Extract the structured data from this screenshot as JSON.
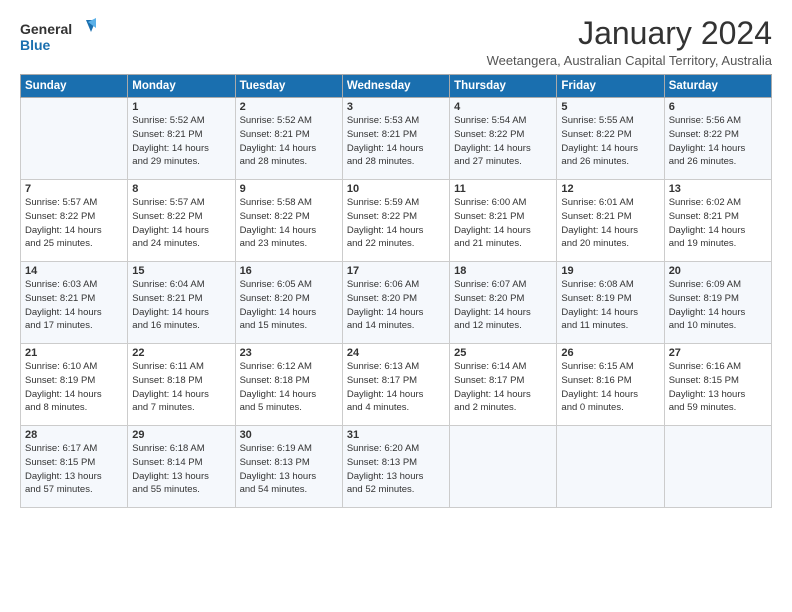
{
  "header": {
    "title": "January 2024",
    "subtitle": "Weetangera, Australian Capital Territory, Australia"
  },
  "days_of_week": [
    "Sunday",
    "Monday",
    "Tuesday",
    "Wednesday",
    "Thursday",
    "Friday",
    "Saturday"
  ],
  "weeks": [
    [
      {
        "day": "",
        "info": ""
      },
      {
        "day": "1",
        "info": "Sunrise: 5:52 AM\nSunset: 8:21 PM\nDaylight: 14 hours\nand 29 minutes."
      },
      {
        "day": "2",
        "info": "Sunrise: 5:52 AM\nSunset: 8:21 PM\nDaylight: 14 hours\nand 28 minutes."
      },
      {
        "day": "3",
        "info": "Sunrise: 5:53 AM\nSunset: 8:21 PM\nDaylight: 14 hours\nand 28 minutes."
      },
      {
        "day": "4",
        "info": "Sunrise: 5:54 AM\nSunset: 8:22 PM\nDaylight: 14 hours\nand 27 minutes."
      },
      {
        "day": "5",
        "info": "Sunrise: 5:55 AM\nSunset: 8:22 PM\nDaylight: 14 hours\nand 26 minutes."
      },
      {
        "day": "6",
        "info": "Sunrise: 5:56 AM\nSunset: 8:22 PM\nDaylight: 14 hours\nand 26 minutes."
      }
    ],
    [
      {
        "day": "7",
        "info": "Sunrise: 5:57 AM\nSunset: 8:22 PM\nDaylight: 14 hours\nand 25 minutes."
      },
      {
        "day": "8",
        "info": "Sunrise: 5:57 AM\nSunset: 8:22 PM\nDaylight: 14 hours\nand 24 minutes."
      },
      {
        "day": "9",
        "info": "Sunrise: 5:58 AM\nSunset: 8:22 PM\nDaylight: 14 hours\nand 23 minutes."
      },
      {
        "day": "10",
        "info": "Sunrise: 5:59 AM\nSunset: 8:22 PM\nDaylight: 14 hours\nand 22 minutes."
      },
      {
        "day": "11",
        "info": "Sunrise: 6:00 AM\nSunset: 8:21 PM\nDaylight: 14 hours\nand 21 minutes."
      },
      {
        "day": "12",
        "info": "Sunrise: 6:01 AM\nSunset: 8:21 PM\nDaylight: 14 hours\nand 20 minutes."
      },
      {
        "day": "13",
        "info": "Sunrise: 6:02 AM\nSunset: 8:21 PM\nDaylight: 14 hours\nand 19 minutes."
      }
    ],
    [
      {
        "day": "14",
        "info": "Sunrise: 6:03 AM\nSunset: 8:21 PM\nDaylight: 14 hours\nand 17 minutes."
      },
      {
        "day": "15",
        "info": "Sunrise: 6:04 AM\nSunset: 8:21 PM\nDaylight: 14 hours\nand 16 minutes."
      },
      {
        "day": "16",
        "info": "Sunrise: 6:05 AM\nSunset: 8:20 PM\nDaylight: 14 hours\nand 15 minutes."
      },
      {
        "day": "17",
        "info": "Sunrise: 6:06 AM\nSunset: 8:20 PM\nDaylight: 14 hours\nand 14 minutes."
      },
      {
        "day": "18",
        "info": "Sunrise: 6:07 AM\nSunset: 8:20 PM\nDaylight: 14 hours\nand 12 minutes."
      },
      {
        "day": "19",
        "info": "Sunrise: 6:08 AM\nSunset: 8:19 PM\nDaylight: 14 hours\nand 11 minutes."
      },
      {
        "day": "20",
        "info": "Sunrise: 6:09 AM\nSunset: 8:19 PM\nDaylight: 14 hours\nand 10 minutes."
      }
    ],
    [
      {
        "day": "21",
        "info": "Sunrise: 6:10 AM\nSunset: 8:19 PM\nDaylight: 14 hours\nand 8 minutes."
      },
      {
        "day": "22",
        "info": "Sunrise: 6:11 AM\nSunset: 8:18 PM\nDaylight: 14 hours\nand 7 minutes."
      },
      {
        "day": "23",
        "info": "Sunrise: 6:12 AM\nSunset: 8:18 PM\nDaylight: 14 hours\nand 5 minutes."
      },
      {
        "day": "24",
        "info": "Sunrise: 6:13 AM\nSunset: 8:17 PM\nDaylight: 14 hours\nand 4 minutes."
      },
      {
        "day": "25",
        "info": "Sunrise: 6:14 AM\nSunset: 8:17 PM\nDaylight: 14 hours\nand 2 minutes."
      },
      {
        "day": "26",
        "info": "Sunrise: 6:15 AM\nSunset: 8:16 PM\nDaylight: 14 hours\nand 0 minutes."
      },
      {
        "day": "27",
        "info": "Sunrise: 6:16 AM\nSunset: 8:15 PM\nDaylight: 13 hours\nand 59 minutes."
      }
    ],
    [
      {
        "day": "28",
        "info": "Sunrise: 6:17 AM\nSunset: 8:15 PM\nDaylight: 13 hours\nand 57 minutes."
      },
      {
        "day": "29",
        "info": "Sunrise: 6:18 AM\nSunset: 8:14 PM\nDaylight: 13 hours\nand 55 minutes."
      },
      {
        "day": "30",
        "info": "Sunrise: 6:19 AM\nSunset: 8:13 PM\nDaylight: 13 hours\nand 54 minutes."
      },
      {
        "day": "31",
        "info": "Sunrise: 6:20 AM\nSunset: 8:13 PM\nDaylight: 13 hours\nand 52 minutes."
      },
      {
        "day": "",
        "info": ""
      },
      {
        "day": "",
        "info": ""
      },
      {
        "day": "",
        "info": ""
      }
    ]
  ]
}
